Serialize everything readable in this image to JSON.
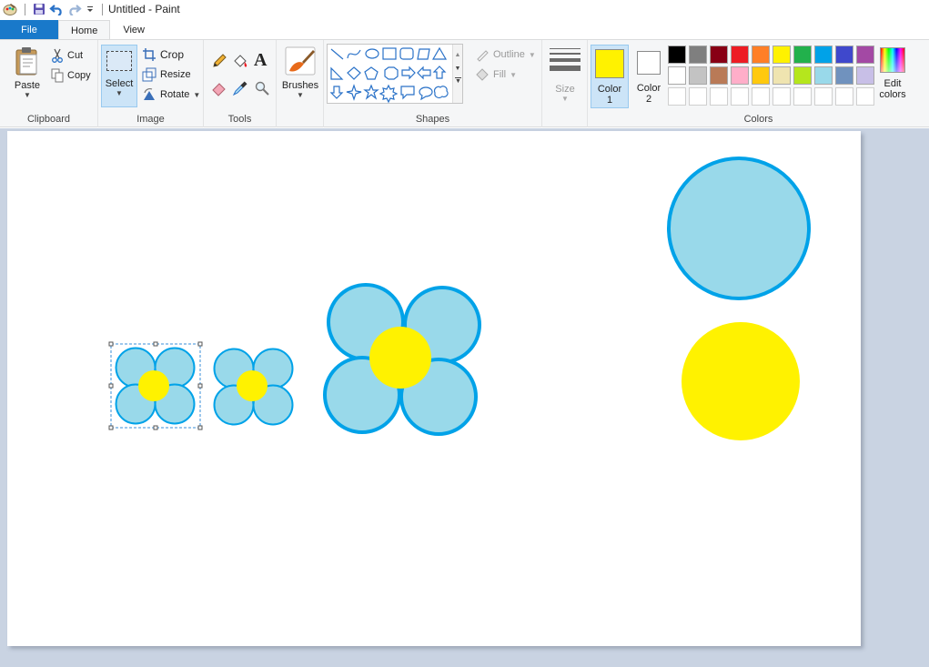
{
  "window": {
    "title": "Untitled - Paint"
  },
  "quick_access": {
    "icons": [
      "paint-app-icon",
      "save-icon",
      "undo-icon",
      "redo-icon",
      "customize-dropdown-icon"
    ]
  },
  "tabs": [
    "File",
    "Home",
    "View"
  ],
  "ribbon": {
    "clipboard": {
      "label": "Clipboard",
      "paste": "Paste",
      "cut": "Cut",
      "copy": "Copy"
    },
    "image": {
      "label": "Image",
      "select": "Select",
      "crop": "Crop",
      "resize": "Resize",
      "rotate": "Rotate"
    },
    "tools": {
      "label": "Tools",
      "icons": [
        "pencil-icon",
        "fill-bucket-icon",
        "text-icon",
        "eraser-icon",
        "color-picker-icon",
        "magnifier-icon"
      ],
      "text_glyph": "A"
    },
    "brushes": {
      "label": "Brushes"
    },
    "shapes": {
      "label": "Shapes",
      "outline": "Outline",
      "fill": "Fill"
    },
    "size": {
      "label": "Size"
    },
    "colors": {
      "label": "Colors",
      "color1": "Color 1",
      "color1_line1": "Color",
      "color1_line2": "1",
      "color2_line1": "Color",
      "color2_line2": "2",
      "color1_value": "#fff200",
      "color2_value": "#ffffff",
      "edit_line1": "Edit",
      "edit_line2": "colors",
      "palette_row1": [
        "#000000",
        "#7f7f7f",
        "#880015",
        "#ed1c24",
        "#ff7f27",
        "#fff200",
        "#22b14c",
        "#00a2e8",
        "#3f48cc",
        "#a349a4"
      ],
      "palette_row2": [
        "#ffffff",
        "#c3c3c3",
        "#b97a57",
        "#ffaec9",
        "#ffc90e",
        "#efe4b0",
        "#b5e61d",
        "#99d9ea",
        "#7092be",
        "#c8bfe7"
      ]
    }
  },
  "canvas_colors": {
    "petal_fill": "#99d9ea",
    "petal_stroke": "#00a2e8",
    "center_fill": "#fff200"
  }
}
